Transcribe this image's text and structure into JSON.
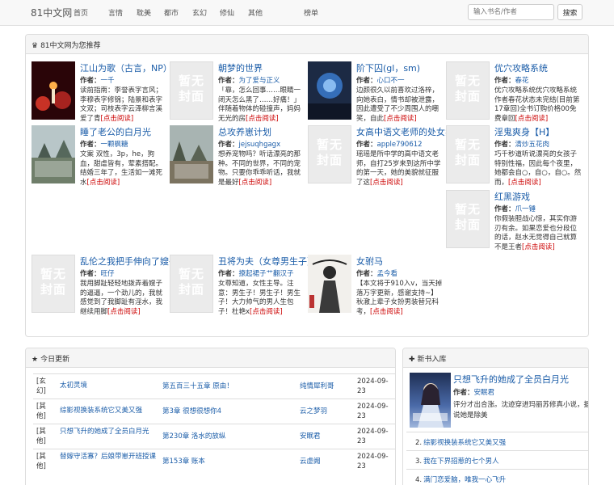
{
  "nav": {
    "brand": "81中文网",
    "items": [
      "首页",
      "言情",
      "耽美",
      "都市",
      "玄幻",
      "修仙",
      "其他",
      "榜单"
    ],
    "search_placeholder": "输入书名/作者",
    "search_button": "搜索"
  },
  "recommend": {
    "heading": "81中文网为您推荐",
    "author_label": "作者：",
    "read_label": "[点击阅读]",
    "placeholder_text": "暂无封面",
    "books": [
      {
        "title": "江山为歌（古言，NP）",
        "author": "一千",
        "intro": "读前指南：李誉表字言风；李穆表字修锦；陆景和表字文双；司枝表字云泽柳言溪爱了青",
        "cover": "photo-red"
      },
      {
        "title": "朝梦的世界",
        "author": "为了爱与正义",
        "intro": "「靠，怎么回事……眼睛一闭天怎么黑了……好痛！」伴随着物体的碰撞声，妈妈无光的房",
        "cover": "placeholder"
      },
      {
        "title": "阶下囚(gl，sm)",
        "author": "心口不一",
        "intro": "边颜很久以前喜欢过洛梓，向她表白，情书却被泄露，因此遭受了不少周围人的嘲笑，自此",
        "cover": "photo-blue"
      },
      {
        "title": "优穴攻略系统",
        "author": "春花",
        "intro": "优穴攻略系统优穴攻略系统作者春花状态未完结(目前第17章回)全书订购价格00免费章回",
        "cover": "placeholder"
      },
      {
        "title": "睡了老公的白月光",
        "author": "一颗枫糖",
        "intro": "文案 双性，3p，he，狗血，甜虐皆有，荤素搭配。结婚三年了，生活如一滩死水",
        "cover": "photo-scenery"
      },
      {
        "title": "总攻养崽计划",
        "author": "jejsuqhgagx",
        "intro": "想养宠物吗？听话漂亮的那种。不同的世界，不同的宠物。只要你乖乖听话，我就是最好",
        "cover": "photo-scenery2"
      },
      {
        "title": "女高中语文老师的处女卖淫经历",
        "author": "apple790612",
        "intro": "瑶瑶是所中学的高中语文老师，自打25岁来到这所中学的第一天，她的美貌就征服了这",
        "cover": "placeholder"
      },
      {
        "title": "淫鬼爽身【H】",
        "author": "清炒五花肉",
        "intro": "巧千秒道听说漂亮的女孩子特别性福，因此每个夜里，她都会自○，自○，自○。然而，",
        "cover": "placeholder"
      },
      {
        "title": "红黑游戏",
        "author": "爪一锤",
        "intro": "你假装胆战心惊，其实你游刃有余。如果恋爱也分段位的话，赵水无觉得自己就算不是王者",
        "cover": "placeholder"
      },
      {
        "title": "乱伦之我把手伸向了嫂子的裙底(繁体)",
        "author": "旺仔",
        "intro": "我用脚趾轻轻地拨弄着嫂子的逼逼，一个劲儿的，我就感觉到了我脚趾有淫水，我继续用脚",
        "cover": "placeholder"
      },
      {
        "title": "丑将为夫（女尊男生子）",
        "author": "撩起裙子艹翻汉子",
        "intro": "女尊知道，女性主导。注意：男生子！男生子！男生子！大力帅气的男人生包子！杜艳x",
        "cover": "placeholder"
      },
      {
        "title": "女驸马",
        "author": "孟今看",
        "intro": "【本文将于910入v，当天掉落万字更新，感谢支持~】秋澈上辈子女扮男装替兄科考，",
        "cover": "photo-ink"
      }
    ]
  },
  "updates": {
    "heading": "今日更新",
    "rows": [
      {
        "cat": "[玄幻]",
        "title": "太初灵境",
        "chapter": "第五百三十五章 原由！",
        "author": "纯情犀利哥",
        "date": "2024-09-23"
      },
      {
        "cat": "[其他]",
        "title": "综影视换装系统它又美又强",
        "chapter": "第3章 很想很想你4",
        "author": "云之梦羽",
        "date": "2024-09-23"
      },
      {
        "cat": "[其他]",
        "title": "只想飞升的她成了全员白月光",
        "chapter": "第230章 洛水的放纵",
        "author": "安眠君",
        "date": "2024-09-23"
      },
      {
        "cat": "[其他]",
        "title": "替嫁守活寡？后娘带崽开班授课",
        "chapter": "第153章 账本",
        "author": "云虚阙",
        "date": "2024-09-23"
      }
    ]
  },
  "newbooks": {
    "heading": "新书入库",
    "featured_title": "只想飞升的她成了全员白月光",
    "author_label": "作者：",
    "featured_author": "安眠君",
    "featured_intro": "评分才出合涨。沈迹穿进玛丽苏修真小说，据说她是除美",
    "list": [
      {
        "num": "2.",
        "title": "综影视换装系统它又美又强"
      },
      {
        "num": "3.",
        "title": "我在下界招惹的七个男人"
      },
      {
        "num": "4.",
        "title": "满门恋爱脑，唯我一心飞升"
      }
    ]
  },
  "colors": {
    "link": "#1a5ca8",
    "read": "#cc0000",
    "panel_head": "#f5f5f5"
  }
}
